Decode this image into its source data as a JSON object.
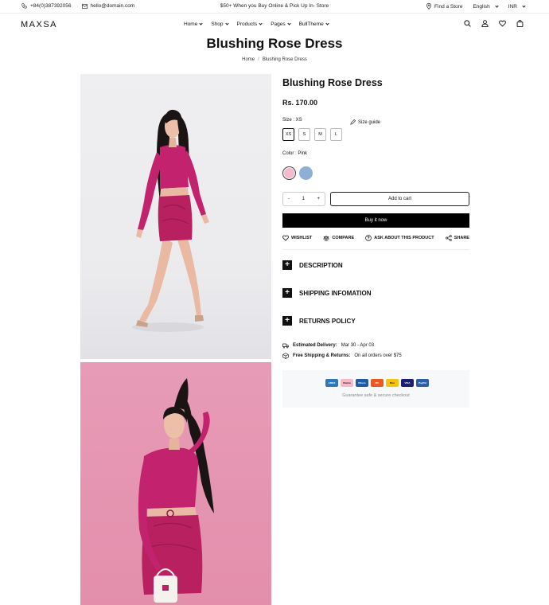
{
  "topbar": {
    "phone": "+84(0)387392056",
    "email": "hello@domain.com",
    "promo": "$50+ When you Buy Online & Pick Up In- Store",
    "find_store": "Find a Store",
    "language": "English",
    "currency": "INR"
  },
  "header": {
    "logo": "MAXSA",
    "nav": [
      "Home",
      "Shop",
      "Products",
      "Pages",
      "BullTheme"
    ]
  },
  "page": {
    "title": "Blushing Rose Dress",
    "breadcrumb": [
      "Home",
      "Blushing Rose Dress"
    ],
    "breadcrumb_sep": "/"
  },
  "product": {
    "title": "Blushing Rose Dress",
    "price": "Rs. 170.00",
    "size_label": "Size : XS",
    "size_guide": "Size guide",
    "sizes": [
      "XS",
      "S",
      "M",
      "L"
    ],
    "selected_size": "XS",
    "color_label": "Color : Pink",
    "colors": [
      {
        "name": "Pink",
        "hex": "#f3b9cd",
        "selected": true
      },
      {
        "name": "Blue",
        "hex": "#8fb0d4",
        "selected": false
      }
    ],
    "quantity": "1",
    "qty_minus": "-",
    "qty_plus": "+",
    "add_to_cart": "Add to cart",
    "buy_now": "Buy it now",
    "actions": [
      "WISHLIST",
      "COMPARE",
      "ASK ABOUT THIS PRODUCT",
      "SHARE"
    ],
    "accordions": [
      "DESCRIPTION",
      "SHIPPING INFOMATION",
      "RETURNS POLICY"
    ],
    "accordion_icon": "+",
    "delivery": {
      "label": "Estimated Delivery:",
      "value": "Mar 30 - Apr 03"
    },
    "shipping": {
      "label": "Free Shipping & Returns:",
      "value": "On all orders over $75"
    },
    "payment_cards": [
      {
        "name": "AMEX",
        "color": "#2e77bc"
      },
      {
        "name": "Klarna",
        "color": "#f5b9c9"
      },
      {
        "name": "Diners",
        "color": "#1f5aa6"
      },
      {
        "name": "MC",
        "color": "#eb5a23"
      },
      {
        "name": "Disc",
        "color": "#f4c40f"
      },
      {
        "name": "VISA",
        "color": "#1a1f71"
      },
      {
        "name": "PayPal",
        "color": "#2c5fa8"
      }
    ],
    "guarantee": "Guarantee safe & secure checkout"
  },
  "colors": {
    "accent": "#000000",
    "image1_bg": "#ececef",
    "image2_bg": "#e597b2",
    "dress": "#c3236e"
  }
}
